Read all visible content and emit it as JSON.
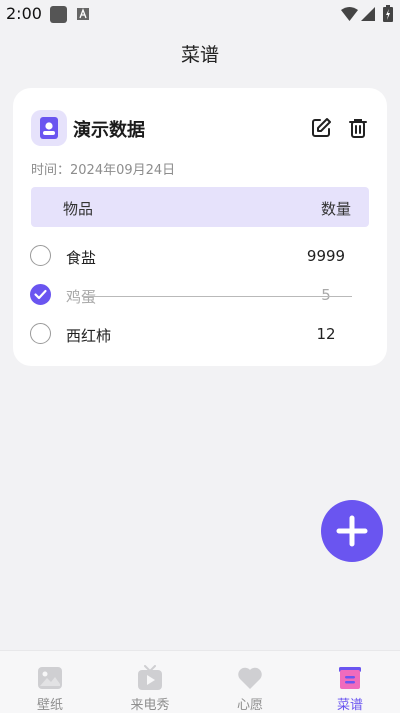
{
  "status_bar": {
    "time": "2:00"
  },
  "page": {
    "title": "菜谱"
  },
  "recipe": {
    "title": "演示数据",
    "time_text": "时间：2024年09月24日",
    "table": {
      "col_item": "物品",
      "col_qty": "数量"
    },
    "items": [
      {
        "name": "食盐",
        "qty": "9999",
        "checked": false
      },
      {
        "name": "鸡蛋",
        "qty": "5",
        "checked": true
      },
      {
        "name": "西红柿",
        "qty": "12",
        "checked": false
      }
    ]
  },
  "tabs": [
    {
      "label": "壁纸",
      "icon": "image-icon",
      "active": false
    },
    {
      "label": "来电秀",
      "icon": "tv-play-icon",
      "active": false
    },
    {
      "label": "心愿",
      "icon": "heart-icon",
      "active": false
    },
    {
      "label": "菜谱",
      "icon": "recipe-icon",
      "active": true
    }
  ],
  "colors": {
    "accent": "#6a55f0",
    "accent_light": "#e6e2fb",
    "background": "#f2f2f4"
  }
}
